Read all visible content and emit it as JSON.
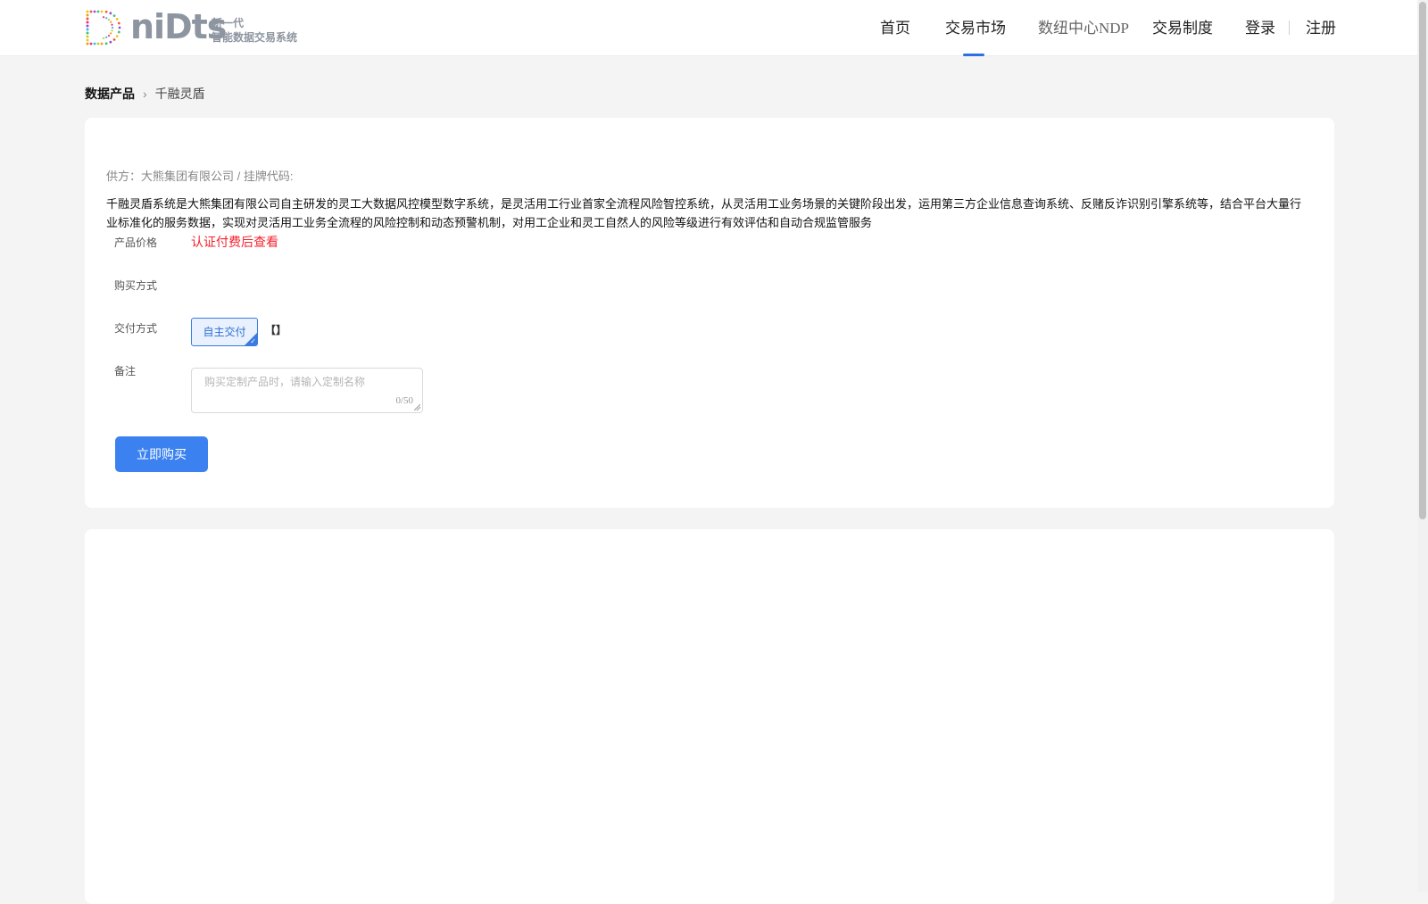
{
  "brand": {
    "wordmark": "niDts",
    "tagline_line1": "新一代",
    "tagline_line2": "智能数据交易系统"
  },
  "nav": {
    "items": [
      {
        "label": "首页"
      },
      {
        "label": "交易市场",
        "active": true
      },
      {
        "label": "数纽中心NDP"
      },
      {
        "label": "交易制度"
      }
    ],
    "login": "登录",
    "register": "注册"
  },
  "breadcrumb": {
    "root": "数据产品",
    "separator": "›",
    "current": "千融灵盾"
  },
  "product": {
    "supplier_prefix": "供方：",
    "supplier_name": "大熊集团有限公司",
    "code_separator": " / ",
    "code_label": "挂牌代码:",
    "description": "千融灵盾系统是大熊集团有限公司自主研发的灵工大数据风控模型数字系统，是灵活用工行业首家全流程风险智控系统，从灵活用工业务场景的关键阶段出发，运用第三方企业信息查询系统、反赌反诈识别引擎系统等，结合平台大量行业标准化的服务数据，实现对灵活用工业务全流程的风险控制和动态预警机制，对用工企业和灵工自然人的风险等级进行有效评估和自动合规监管服务"
  },
  "form": {
    "price_label": "产品价格",
    "price_value": "认证付费后查看",
    "purchase_label": "购买方式",
    "delivery_label": "交付方式",
    "delivery_option": "自主交付",
    "delivery_extra": "【】",
    "remark_label": "备注",
    "remark_placeholder": "购买定制产品时，请输入定制名称",
    "remark_value": "",
    "remark_counter": "0/50",
    "buy_button": "立即购买"
  },
  "colors": {
    "accent": "#3b82f0",
    "price_red": "#f5222d",
    "page_bg": "#f4f4f4"
  }
}
